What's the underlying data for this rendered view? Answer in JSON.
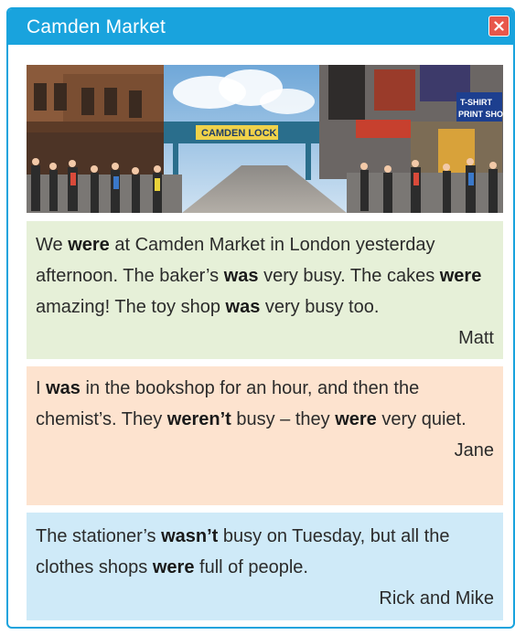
{
  "window": {
    "title": "Camden Market",
    "close_icon": "close-x-icon",
    "accent_color": "#19a3dd",
    "close_color": "#e8574b"
  },
  "photo": {
    "signs": [
      "CAMDEN LOCK",
      "T-SHIRT PRINT SHOP"
    ]
  },
  "posts": [
    {
      "color": "#e6f0d8",
      "segments": [
        "We ",
        "were",
        " at Camden Market in London yesterday afternoon. The baker’s ",
        "was",
        " very busy. The cakes ",
        "were",
        " amazing! The toy shop ",
        "was",
        " very busy too."
      ],
      "author": "Matt"
    },
    {
      "color": "#fde3cf",
      "segments": [
        "I ",
        "was",
        " in the bookshop for an hour, and then the chemist’s. They ",
        "weren’t",
        " busy – they ",
        "were",
        " very quiet."
      ],
      "author": "Jane"
    },
    {
      "color": "#cfeaf8",
      "segments": [
        "The stationer’s ",
        "wasn’t",
        " busy on Tuesday, but all the clothes shops ",
        "were",
        " full of people."
      ],
      "author": "Rick and Mike"
    }
  ]
}
